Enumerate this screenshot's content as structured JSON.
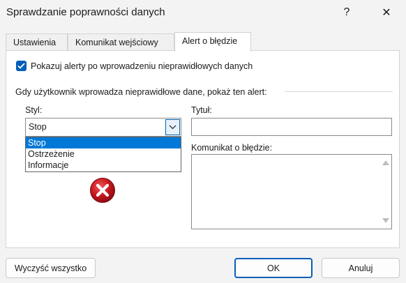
{
  "window": {
    "title": "Sprawdzanie poprawności danych",
    "help_glyph": "?",
    "close_glyph": "✕"
  },
  "tabs": [
    {
      "label": "Ustawienia",
      "active": false
    },
    {
      "label": "Komunikat wejściowy",
      "active": false
    },
    {
      "label": "Alert o błędzie",
      "active": true
    }
  ],
  "alert": {
    "show_alerts_checked": true,
    "show_alerts_label": "Pokazuj alerty po wprowadzeniu nieprawidłowych danych",
    "section_label": "Gdy użytkownik wprowadza nieprawidłowe dane, pokaż ten alert:",
    "style_label": "Styl:",
    "style_value": "Stop",
    "style_options": [
      "Stop",
      "Ostrzeżenie",
      "Informacje"
    ],
    "title_label": "Tytuł:",
    "title_value": "",
    "message_label": "Komunikat o błędzie:",
    "message_value": ""
  },
  "buttons": {
    "clear_all": "Wyczyść wszystko",
    "ok": "OK",
    "cancel": "Anuluj"
  },
  "colors": {
    "accent": "#005fb8",
    "selection": "#0078d7",
    "error_icon": "#c4161c"
  }
}
